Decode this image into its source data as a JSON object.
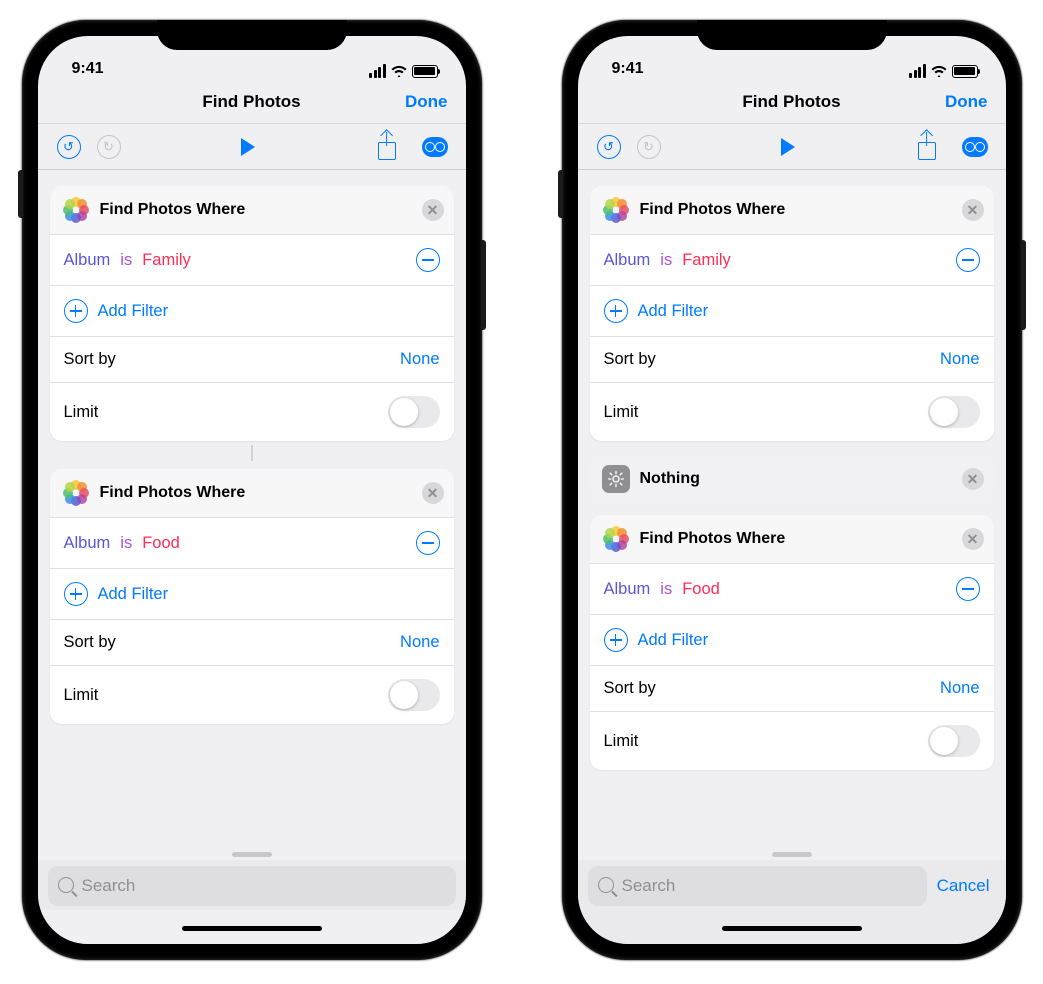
{
  "status": {
    "time": "9:41"
  },
  "nav": {
    "title": "Find Photos",
    "done": "Done"
  },
  "card": {
    "title": "Find Photos Where",
    "field": "Album",
    "op": "is",
    "addFilter": "Add Filter",
    "sortLabel": "Sort by",
    "sortValue": "None",
    "limitLabel": "Limit"
  },
  "values": {
    "family": "Family",
    "food": "Food"
  },
  "nothing": {
    "title": "Nothing"
  },
  "search": {
    "placeholder": "Search",
    "cancel": "Cancel"
  }
}
